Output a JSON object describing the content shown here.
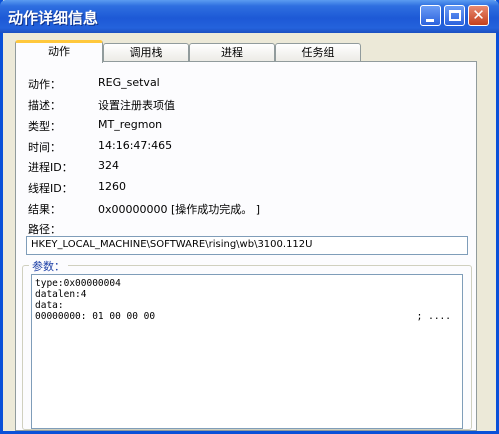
{
  "window": {
    "title": "动作详细信息",
    "minimize_glyph": "",
    "close_glyph": "✕"
  },
  "tabs": [
    {
      "label": "动作",
      "active": true
    },
    {
      "label": "调用栈",
      "active": false
    },
    {
      "label": "进程",
      "active": false
    },
    {
      "label": "任务组",
      "active": false
    }
  ],
  "details": {
    "action": {
      "label": "动作：",
      "value": "REG_setval"
    },
    "description": {
      "label": "描述：",
      "value": "设置注册表项值"
    },
    "type": {
      "label": "类型：",
      "value": "MT_regmon"
    },
    "time": {
      "label": "时间：",
      "value": "14:16:47:465"
    },
    "pid": {
      "label": "进程ID：",
      "value": "324"
    },
    "tid": {
      "label": "线程ID：",
      "value": "1260"
    },
    "result": {
      "label": "结果：",
      "value": "0x00000000 [操作成功完成。 ]"
    }
  },
  "path": {
    "label": "路径：",
    "value": "HKEY_LOCAL_MACHINE\\SOFTWARE\\rising\\wb\\3100.112U"
  },
  "params": {
    "label": "参数：",
    "lines": [
      "type:0x00000004",
      "datalen:4",
      "data:",
      "00000000: 01 00 00 00"
    ],
    "hex_ascii": "; ...."
  }
}
